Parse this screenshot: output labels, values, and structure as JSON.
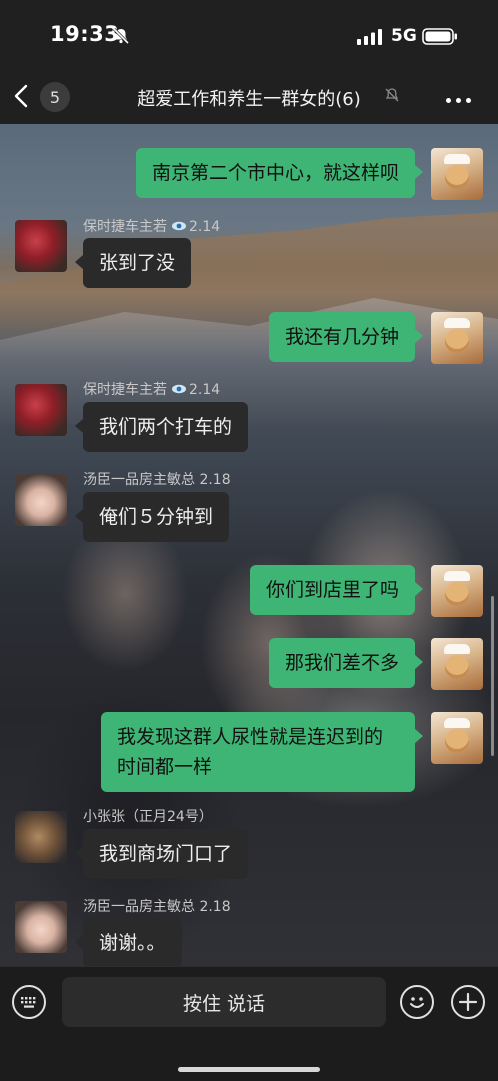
{
  "status_bar": {
    "time": "19:33",
    "network": "5G"
  },
  "header": {
    "unread_count": "5",
    "title": "超爱工作和养生一群女的(6)"
  },
  "messages": [
    {
      "side": "out",
      "text": "南京第二个市中心，就这样呗"
    },
    {
      "side": "in",
      "sender": "保时捷车主若",
      "sender_suffix": "2.14",
      "text": "张到了没"
    },
    {
      "side": "out",
      "text": "我还有几分钟"
    },
    {
      "side": "in",
      "sender": "保时捷车主若",
      "sender_suffix": "2.14",
      "text": "我们两个打车的"
    },
    {
      "side": "in",
      "sender": "汤臣一品房主敏总 2.18",
      "text": "俺们５分钟到"
    },
    {
      "side": "out",
      "text": "你们到店里了吗"
    },
    {
      "side": "out",
      "text": "那我们差不多"
    },
    {
      "side": "out",
      "text": "我发现这群人尿性就是连迟到的时间都一样"
    },
    {
      "side": "in",
      "sender": "小张张（正月24号）",
      "text": "我到商场门口了"
    },
    {
      "side": "in",
      "sender": "汤臣一品房主敏总 2.18",
      "text": "谢谢。。"
    }
  ],
  "input_bar": {
    "hold_to_talk": "按住 说话"
  },
  "icons": {
    "mute": "bell-slash-icon",
    "signal": "signal-bars-icon",
    "battery": "battery-icon",
    "back": "chevron-left-icon",
    "more": "more-dots-icon",
    "eye": "eye-icon",
    "keyboard": "keyboard-icon",
    "emoji": "smiley-icon",
    "plus": "plus-icon"
  },
  "colors": {
    "outgoing_bubble": "#3eb575",
    "incoming_bubble": "#2a2a2a",
    "bar_background": "#202020"
  }
}
